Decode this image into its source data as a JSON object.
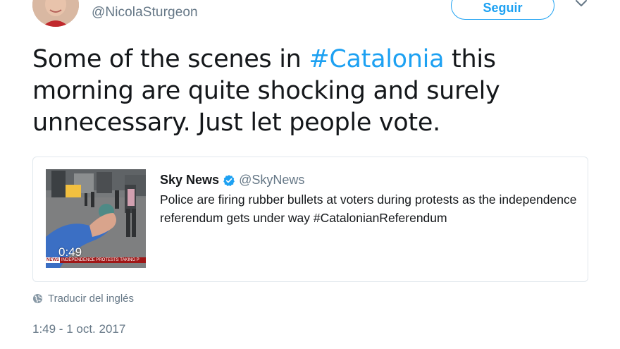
{
  "header": {
    "handle": "@NicolaSturgeon",
    "follow_label": "Seguir",
    "menu_icon": "chevron-down-icon"
  },
  "tweet": {
    "text_before": "Some of the scenes in ",
    "hashtag": "#Catalonia",
    "text_after": " this morning are quite shocking and surely unnecessary. Just let people vote."
  },
  "quoted": {
    "name": "Sky News",
    "verified_icon": "verified-badge-icon",
    "handle": "@SkyNews",
    "text": "Police are firing rubber bullets at voters during protests as the independence referendum gets under way #CatalonianReferendum",
    "video": {
      "duration": "0:49",
      "ticker_brand": "NEWS",
      "ticker_text": "INDEPENDENCE PROTESTS TAKING P"
    }
  },
  "footer": {
    "translate_label": "Traducir del inglés",
    "translate_icon": "globe-icon",
    "timestamp": "1:49 - 1 oct. 2017"
  },
  "colors": {
    "accent": "#1da1f2",
    "text": "#14171a",
    "muted": "#657786",
    "border": "#e1e8ed"
  }
}
